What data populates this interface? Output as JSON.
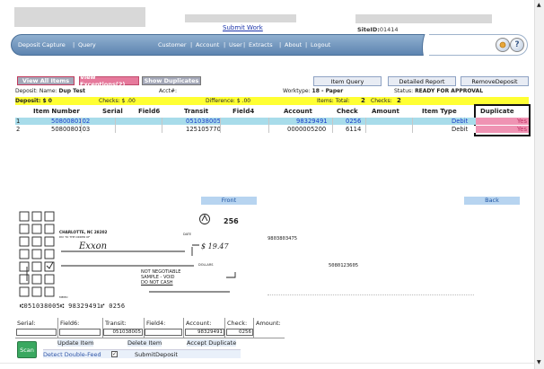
{
  "header": {
    "submit_link": "Submit Work",
    "site_label": "SiteID:",
    "site_value": "01414"
  },
  "nav": {
    "items": [
      "Deposit Capture",
      "Query",
      "Customer",
      "Account",
      "User",
      "Extracts",
      "About",
      "Logout"
    ],
    "help_icon": "?"
  },
  "tabs": {
    "view_all": "View All Items",
    "view_exceptions": "View Exceptions(2)",
    "show_duplicates": "Show Duplicates"
  },
  "toolbar": {
    "item_query": "Item Query",
    "detailed_report": "Detailed Report",
    "remove_deposit": "RemoveDeposit"
  },
  "deposit_info": {
    "name_label": "Deposit: Name:",
    "name_value": "Dup Test",
    "acct_label": "Acct#:",
    "acct_value": "",
    "worktype_label": "Worktype:",
    "worktype_value": "18 - Paper",
    "status_label": "Status:",
    "status_value": "READY FOR APPROVAL"
  },
  "totals": {
    "deposit": "Deposit: $ 0",
    "checks": "Checks: $ .00",
    "difference": "Difference: $ .00",
    "items_total_label": "Items:  Total:",
    "items_total": "2",
    "checks_label": "Checks:",
    "checks_count": "2"
  },
  "table": {
    "headers": [
      "Item Number",
      "Serial",
      "Field6",
      "Transit",
      "Field4",
      "Account",
      "Check",
      "Amount",
      "Item Type",
      "Duplicate"
    ],
    "rows": [
      {
        "idx": "1",
        "item_number": "5080080102",
        "serial": "",
        "field6": "",
        "transit": "051038005",
        "field4": "",
        "account": "98329491",
        "check": "0256",
        "amount": "",
        "item_type": "Debit",
        "duplicate": "Yes"
      },
      {
        "idx": "2",
        "item_number": "5080080103",
        "serial": "",
        "field6": "",
        "transit": "125105770",
        "field4": "",
        "account": "0000005200",
        "check": "6114",
        "amount": "",
        "item_type": "Debit",
        "duplicate": "Yes"
      }
    ]
  },
  "image_tabs": {
    "front": "Front",
    "back": "Back"
  },
  "check_image": {
    "number": "256",
    "location": "CHARLOTTE, NC  28202",
    "pay_to": "PAY TO THE ORDER OF",
    "payee": "Exxon",
    "amount": "19.47",
    "not_negotiable": "NOT NEGOTIABLE",
    "sample_void": "SAMPLE - VOID",
    "no_cash": "DO  NOT  CASH",
    "memo": "MEMO",
    "micr": "⑆051038005⑆ 98329491⑈ 0256",
    "back_micr_1": "9803803475",
    "back_micr_2": "5080123605",
    "date_label": "DATE",
    "dollars_label": "DOLLARS"
  },
  "form": {
    "labels": [
      "Serial:",
      "Field6:",
      "Transit:",
      "Field4:",
      "Account:",
      "Check:",
      "Amount:"
    ],
    "values": [
      "",
      "",
      "051038005",
      "",
      "98329491",
      "0256",
      ""
    ]
  },
  "actions": {
    "scan": "Scan",
    "update_item": "Update Item",
    "delete_item": "Delete Item",
    "accept_duplicate": "Accept Duplicate",
    "detect_double_feed": "Detect Double-Feed",
    "submit_deposit": "SubmitDeposit"
  }
}
